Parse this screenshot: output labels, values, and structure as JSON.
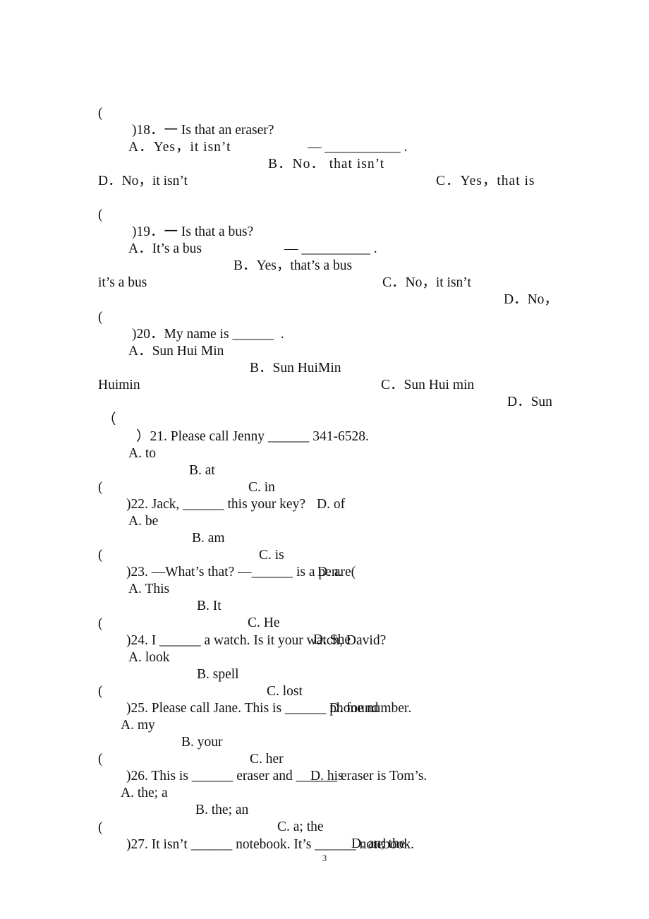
{
  "page": {
    "page_number": "3",
    "questions": [
      {
        "number": "18",
        "stem_segments": [
          "(",
          ")18．一 Is that an eraser?",
          "— ___________ ."
        ],
        "option_segments": [
          "A．Yes，it isn’t",
          "B．No． that isn’t",
          "C．Yes，that is"
        ],
        "continuation": "D．No，it isn’t"
      },
      {
        "number": "19",
        "stem_segments": [
          "(",
          ")19．一 Is that a bus?",
          "— __________ ."
        ],
        "option_segments": [
          "A．It’s a bus",
          "B．Yes，that’s a bus",
          "C．No，it isn’t",
          "D．No，"
        ],
        "continuation": "it’s a bus"
      },
      {
        "number": "20",
        "stem_segments": [
          "(",
          ")20．My name is ______  ."
        ],
        "option_segments": [
          "A．Sun Hui Min",
          "B．Sun HuiMin",
          "C．Sun Hui min",
          "D．Sun"
        ],
        "continuation": "Huimin"
      },
      {
        "number": "21",
        "stem_segments": [
          "（",
          "）21. Please call Jenny ______ 341-6528."
        ],
        "option_segments": [
          "A. to",
          "B. at",
          "C. in",
          "D. of"
        ]
      },
      {
        "number": "22",
        "stem_segments": [
          "(",
          ")22. Jack, ______ this your key?"
        ],
        "option_segments": [
          "A. be",
          "B. am",
          "C. is",
          "D. are("
        ]
      },
      {
        "number": "23",
        "stem_segments": [
          "(",
          ")23. —What’s that? —______ is a pen."
        ],
        "option_segments": [
          "A. This",
          "B. It",
          "C. He",
          "D. She"
        ]
      },
      {
        "number": "24",
        "stem_segments": [
          "(",
          ")24. I ______ a watch. Is it your watch, David?"
        ],
        "option_segments": [
          "A. look",
          "B. spell",
          "C. lost",
          "D. found"
        ]
      },
      {
        "number": "25",
        "stem_segments": [
          "(",
          ")25. Please call Jane. This is ______ phone number."
        ],
        "option_segments": [
          "A. my",
          "B. your",
          "C. her",
          "D. his"
        ]
      },
      {
        "number": "26",
        "stem_segments": [
          "(",
          ")26. This is ______ eraser and ______ eraser is Tom’s."
        ],
        "option_segments": [
          "A. the; a",
          "B. the; an",
          "C. a; the",
          "D. an; the"
        ]
      },
      {
        "number": "27",
        "stem_segments": [
          "(",
          ")27. It isn’t ______ notebook. It’s ______ notebook."
        ]
      }
    ]
  }
}
